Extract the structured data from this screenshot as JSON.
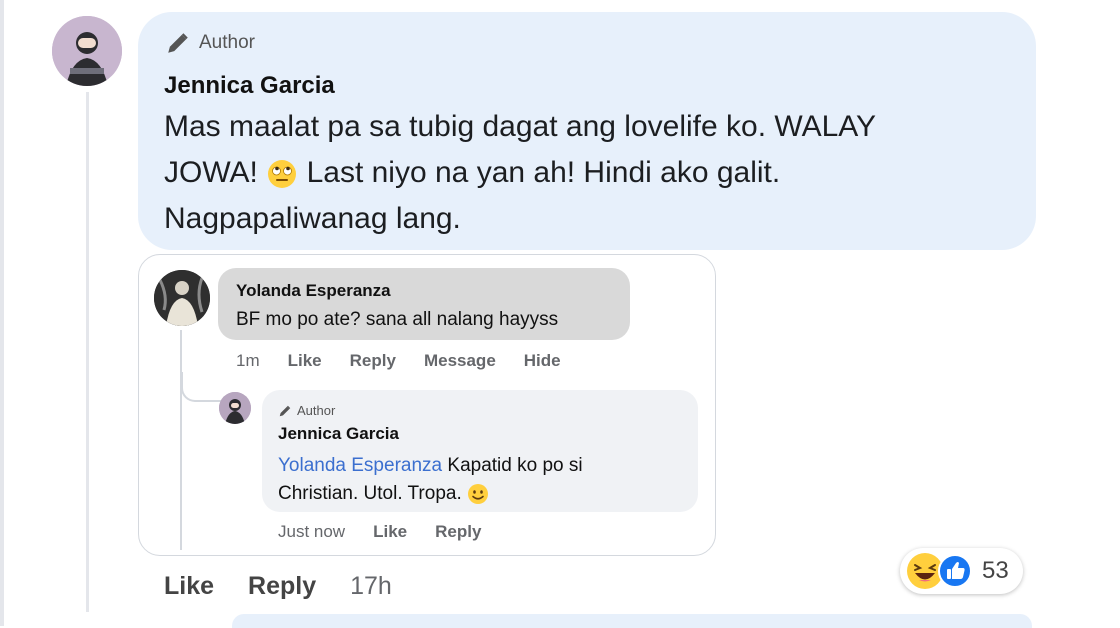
{
  "main_comment": {
    "author_badge": "Author",
    "author_name": "Jennica Garcia",
    "text_line1": "Mas maalat pa sa tubig dagat ang lovelife ko. WALAY",
    "text_line2_a": "JOWA!",
    "text_line2_b": "Last niyo na yan ah! Hindi ako galit.",
    "text_line3": "Nagpapaliwanag lang.",
    "emoji": "face-with-rolling-eyes-icon",
    "actions": {
      "like": "Like",
      "reply": "Reply",
      "time": "17h"
    },
    "reactions": {
      "icons": [
        "laughing-emoji-icon",
        "like-thumb-icon"
      ],
      "count": "53"
    }
  },
  "reply": {
    "author_name": "Yolanda Esperanza",
    "text": "BF mo po ate? sana all nalang hayyss",
    "actions": {
      "time": "1m",
      "like": "Like",
      "reply": "Reply",
      "message": "Message",
      "hide": "Hide"
    }
  },
  "nested_reply": {
    "author_badge": "Author",
    "author_name": "Jennica Garcia",
    "mention": "Yolanda Esperanza",
    "text_a": "Kapatid ko po si",
    "text_b": "Christian. Utol. Tropa.",
    "emoji": "smiling-face-icon",
    "actions": {
      "time": "Just now",
      "like": "Like",
      "reply": "Reply"
    }
  },
  "colors": {
    "main_bubble": "#e7f0fb",
    "reply_bubble": "#d9d9d9",
    "nested_bubble": "#f0f2f5",
    "mention": "#3b6fcf",
    "like_blue": "#1877f2"
  }
}
